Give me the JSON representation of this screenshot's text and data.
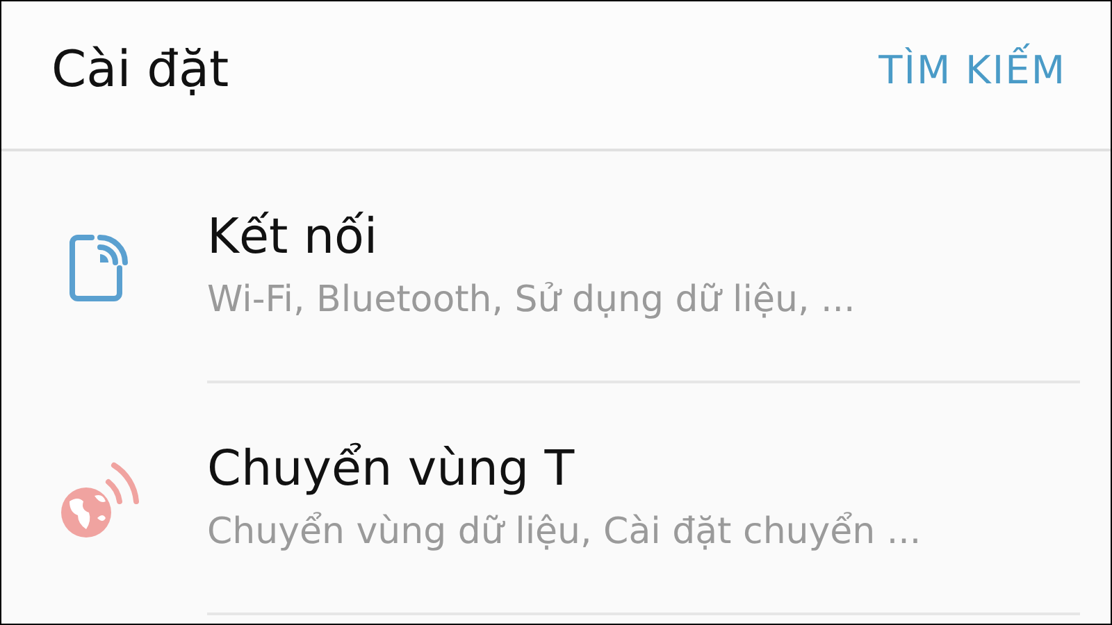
{
  "header": {
    "title": "Cài đặt",
    "action": "TÌM KIẾM"
  },
  "items": [
    {
      "kind": "connections",
      "title": "Kết nối",
      "subtitle": "Wi-Fi, Bluetooth, Sử dụng dữ liệu, ..."
    },
    {
      "kind": "roaming",
      "title": "Chuyển vùng T",
      "subtitle": "Chuyển vùng dữ liệu, Cài đặt chuyển ..."
    }
  ]
}
